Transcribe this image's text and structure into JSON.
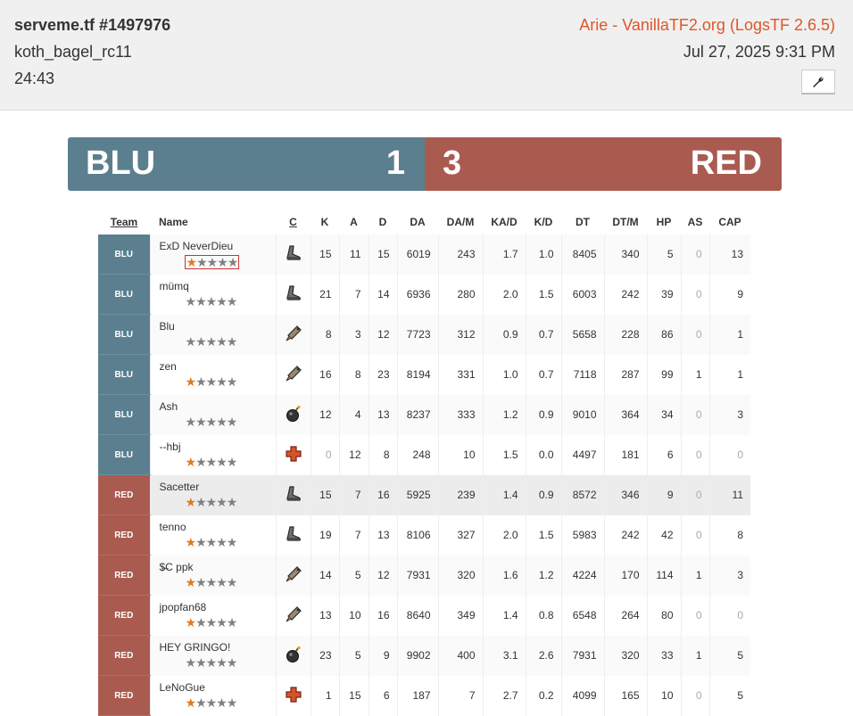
{
  "header": {
    "title": "serveme.tf #1497976",
    "map": "koth_bagel_rc11",
    "duration": "24:43",
    "server": "Arie - VanillaTF2.org (LogsTF 2.6.5)",
    "date": "Jul 27, 2025 9:31 PM",
    "tool_icon": "wrench-icon"
  },
  "scoreboard": {
    "blu_name": "BLU",
    "blu_score": "1",
    "red_score": "3",
    "red_name": "RED",
    "blu_color": "#5b7f8f",
    "red_color": "#aa5b50"
  },
  "columns": [
    "Team",
    "Name",
    "C",
    "K",
    "A",
    "D",
    "DA",
    "DA/M",
    "KA/D",
    "K/D",
    "DT",
    "DT/M",
    "HP",
    "AS",
    "CAP"
  ],
  "players": [
    {
      "team": "BLU",
      "name": "ExD NeverDieu",
      "stars": 1,
      "cls": "scout",
      "k": "15",
      "a": "11",
      "d": "15",
      "da": "6019",
      "dam": "243",
      "kad": "1.7",
      "kd": "1.0",
      "dt": "8405",
      "dtm": "340",
      "hp": "5",
      "as": "0",
      "cap": "13"
    },
    {
      "team": "BLU",
      "name": "mümq",
      "stars": 0,
      "cls": "scout",
      "k": "21",
      "a": "7",
      "d": "14",
      "da": "6936",
      "dam": "280",
      "kad": "2.0",
      "kd": "1.5",
      "dt": "6003",
      "dtm": "242",
      "hp": "39",
      "as": "0",
      "cap": "9"
    },
    {
      "team": "BLU",
      "name": "Blu",
      "stars": 0,
      "cls": "soldier",
      "k": "8",
      "a": "3",
      "d": "12",
      "da": "7723",
      "dam": "312",
      "kad": "0.9",
      "kd": "0.7",
      "dt": "5658",
      "dtm": "228",
      "hp": "86",
      "as": "0",
      "cap": "1"
    },
    {
      "team": "BLU",
      "name": "zen",
      "stars": 1,
      "cls": "soldier",
      "k": "16",
      "a": "8",
      "d": "23",
      "da": "8194",
      "dam": "331",
      "kad": "1.0",
      "kd": "0.7",
      "dt": "7118",
      "dtm": "287",
      "hp": "99",
      "as": "1",
      "cap": "1"
    },
    {
      "team": "BLU",
      "name": "Ash",
      "stars": 0,
      "cls": "demoman",
      "k": "12",
      "a": "4",
      "d": "13",
      "da": "8237",
      "dam": "333",
      "kad": "1.2",
      "kd": "0.9",
      "dt": "9010",
      "dtm": "364",
      "hp": "34",
      "as": "0",
      "cap": "3"
    },
    {
      "team": "BLU",
      "name": "--hbj",
      "stars": 1,
      "cls": "medic",
      "k": "0",
      "a": "12",
      "d": "8",
      "da": "248",
      "dam": "10",
      "kad": "1.5",
      "kd": "0.0",
      "dt": "4497",
      "dtm": "181",
      "hp": "6",
      "as": "0",
      "cap": "0"
    },
    {
      "team": "RED",
      "name": "Sacetter",
      "stars": 1,
      "cls": "scout",
      "k": "15",
      "a": "7",
      "d": "16",
      "da": "5925",
      "dam": "239",
      "kad": "1.4",
      "kd": "0.9",
      "dt": "8572",
      "dtm": "346",
      "hp": "9",
      "as": "0",
      "cap": "11"
    },
    {
      "team": "RED",
      "name": "tenno",
      "stars": 1,
      "cls": "scout",
      "k": "19",
      "a": "7",
      "d": "13",
      "da": "8106",
      "dam": "327",
      "kad": "2.0",
      "kd": "1.5",
      "dt": "5983",
      "dtm": "242",
      "hp": "42",
      "as": "0",
      "cap": "8"
    },
    {
      "team": "RED",
      "name": "$̶C ppk",
      "stars": 1,
      "cls": "soldier",
      "k": "14",
      "a": "5",
      "d": "12",
      "da": "7931",
      "dam": "320",
      "kad": "1.6",
      "kd": "1.2",
      "dt": "4224",
      "dtm": "170",
      "hp": "114",
      "as": "1",
      "cap": "3"
    },
    {
      "team": "RED",
      "name": "jpopfan68",
      "stars": 1,
      "cls": "soldier",
      "k": "13",
      "a": "10",
      "d": "16",
      "da": "8640",
      "dam": "349",
      "kad": "1.4",
      "kd": "0.8",
      "dt": "6548",
      "dtm": "264",
      "hp": "80",
      "as": "0",
      "cap": "0"
    },
    {
      "team": "RED",
      "name": "HEY GRINGO!",
      "stars": 0,
      "cls": "demoman",
      "k": "23",
      "a": "5",
      "d": "9",
      "da": "9902",
      "dam": "400",
      "kad": "3.1",
      "kd": "2.6",
      "dt": "7931",
      "dtm": "320",
      "hp": "33",
      "as": "1",
      "cap": "5"
    },
    {
      "team": "RED",
      "name": "LeNoGue",
      "stars": 1,
      "cls": "medic",
      "k": "1",
      "a": "15",
      "d": "6",
      "da": "187",
      "dam": "7",
      "kad": "2.7",
      "kd": "0.2",
      "dt": "4099",
      "dtm": "165",
      "hp": "10",
      "as": "0",
      "cap": "5"
    }
  ],
  "icons": {
    "scout": "scout-class-icon",
    "soldier": "soldier-class-icon",
    "demoman": "demoman-class-icon",
    "medic": "medic-class-icon",
    "star": "star-icon"
  },
  "colors": {
    "accent_link": "#e0562a",
    "star_on": "#e07a1f",
    "star_off": "#808080",
    "selected_box": "#cc3333"
  }
}
